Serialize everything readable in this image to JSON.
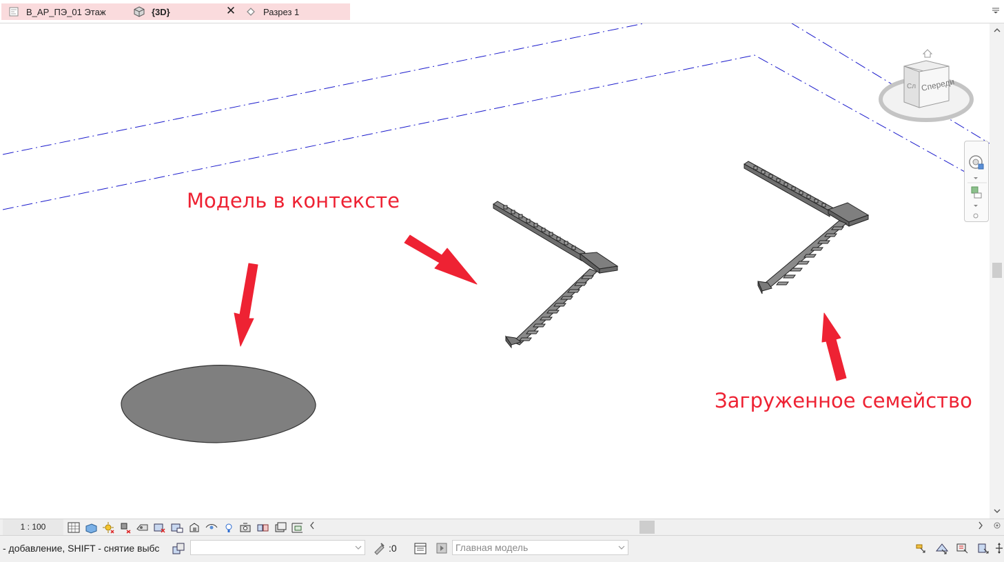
{
  "tabs": [
    {
      "label": "В_АР_ПЭ_01 Этаж",
      "icon": "floor-plan-icon",
      "active": false
    },
    {
      "label": "{3D}",
      "icon": "3d-view-icon",
      "active": true
    },
    {
      "label": "Разрез 1",
      "icon": "section-icon",
      "active": false
    }
  ],
  "viewport": {
    "annotations": {
      "in_place_model": "Модель в контексте",
      "loaded_family": "Загруженное семейство"
    },
    "annotation_color": "#ee2233",
    "viewcube_label": "Спереди",
    "viewcube_side_label": "Сл"
  },
  "view_control": {
    "scale": "1 : 100",
    "icons": [
      "detail-level-icon",
      "visual-style-icon",
      "sun-path-icon",
      "shadows-icon",
      "render-icon",
      "crop-view-icon",
      "show-crop-icon",
      "unlock-3d-icon",
      "temporary-hide-icon",
      "reveal-hidden-icon",
      "analytical-model-icon",
      "highlight-displacement-icon",
      "reveal-constraints-icon",
      "worksharing-display-icon"
    ]
  },
  "status": {
    "text": "- добавление, SHIFT - снятие выбс",
    "workset_value": "",
    "editable_count": ":0",
    "design_option": "Главная модель"
  },
  "colors": {
    "tab_strip_bg": "#fadbdd",
    "level_line": "#1a1acc",
    "solid_fill": "#7f7f7f",
    "stair_fill": "#8a8a8a"
  }
}
